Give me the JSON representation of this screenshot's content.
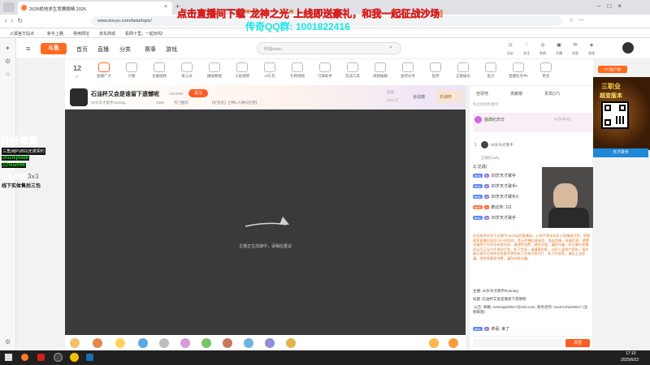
{
  "browser": {
    "tab_title": "2025绝地求生竞赛眼睛 2025",
    "url": "www.douyu.com/beta/topic/",
    "bookmarks": [
      "火狐官方站点",
      "新手上路",
      "常用网址",
      "京东商城",
      "看网十里，一起玩吗!"
    ]
  },
  "overlay": {
    "banner": "点击直播间下载\"龙神之光\"上线即送豪礼，和我一起征战沙场!",
    "qq": "传奇QQ群: 1001822416"
  },
  "site": {
    "logo": "斗鱼",
    "nav": [
      "首页",
      "直播",
      "分类",
      "赛事",
      "游戏"
    ],
    "search_placeholder": "阿福sfasu",
    "user_links": [
      "历史",
      "关注",
      "鱼吧",
      "开播",
      "消息",
      "游戏",
      "下载"
    ]
  },
  "categories": {
    "count": "12",
    "count_label": "个",
    "items": [
      "直播广大",
      "只狼",
      "主播视频",
      "爱心派",
      "播报数据",
      "斗鱼视频",
      "AI礼包",
      "礼物视频",
      "刀锋助手",
      "实战工具",
      "视频编辑",
      "鱼吧分享",
      "鱼吧",
      "正版娱乐",
      "鱼力",
      "直播任务中心",
      "更多"
    ]
  },
  "room": {
    "title": "石油杯又会是谁留下遗憾呢",
    "room_id": "1834885",
    "follow_label": "关注",
    "streamer": "20岁天才歌手running",
    "tags": [
      "1000",
      "热门推荐",
      "【好消息】召唤1人横扫狂野】"
    ],
    "hot_label": "直播",
    "hot_value": "2021万",
    "action_full": "全站榜",
    "action_rank": "石油杯"
  },
  "player": {
    "loading_text": "主播正在加速中，请稍后重试"
  },
  "right_ad": {
    "tag1": "PC鱼户端",
    "tag2": "三职业",
    "tag3": "超变版本",
    "qr_caption": "领了么福",
    "bottom": "天才歌手"
  },
  "left_ad": {
    "title": "汁汁电竞",
    "sub": "三角洲|PUBG|无畏契约",
    "id1": "zhizhipwd6",
    "id2": "ZZteam66",
    "line1": "护航代肝3x3",
    "line2": "线下实体售后三包"
  },
  "chat": {
    "tabs": [
      "自领地",
      "贡献榜",
      "贵宾(17)"
    ],
    "notice": "粉丝榜福利推荐",
    "event_title": "盛典纪念日",
    "event_time": "22日6月4日",
    "rank_label": "20岁天才歌手",
    "rank_num": "1",
    "sub_label": "正确的sally",
    "welcome_title": "1) 达成/",
    "lines": [
      "20岁天才歌手",
      "20岁天才歌手r",
      "20岁天才歌手3",
      "鹅比你: 111",
      "20岁天才歌手"
    ],
    "intro": "欢迎来到20岁天才歌手running的直播间。斗鱼严禁未成年人直播或打赏，提倡理性直播内容及24小时陪伴、禁止传播封建迷信、低俗色情、吸烟饮酒、赌博诈骗等行为违法有害内容。请理性消费，理性应援，谨防诈骗。如主播在直播间以不正当方式诱导打赏、私下交易，请谨慎判断，以防人身财产损失。请在聊天群外切勿听信来路不明的私下交易代练代打、私下交易等，谨防上当受骗。理性观看和消费，谨防网络诈骗。",
    "info_host": "主播: 20岁天才歌手Running",
    "info_title": "标题: 石油杯又会是谁留下遗憾呢",
    "info_contact": "·公告: 邮箱: running520617@163.com; 商务合作: nuomi-shine0617 (注明来意)",
    "bottom_msg": "恭喜: 来了",
    "input_placeholder": "",
    "send_label": "发送"
  },
  "taskbar": {
    "time": "17:10",
    "date": "2025/6/22"
  },
  "colors": {
    "accent": "#ff5d23",
    "overlay_yellow": "#ffe600",
    "overlay_cyan": "#19e6e6",
    "ad_green": "#1ad81a"
  }
}
